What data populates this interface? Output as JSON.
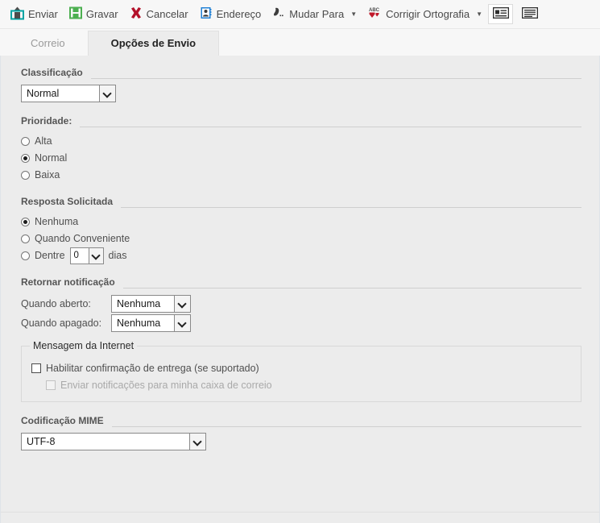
{
  "toolbar": {
    "items": [
      {
        "label": "Enviar",
        "icon": "send-icon",
        "has_caret": false
      },
      {
        "label": "Gravar",
        "icon": "save-icon",
        "has_caret": false
      },
      {
        "label": "Cancelar",
        "icon": "cancel-icon",
        "has_caret": false
      },
      {
        "label": "Endereço",
        "icon": "address-book-icon",
        "has_caret": false
      },
      {
        "label": "Mudar Para",
        "icon": "change-to-icon",
        "has_caret": true
      },
      {
        "label": "Corrigir Ortografia",
        "icon": "spellcheck-icon",
        "has_caret": true
      }
    ],
    "view_buttons": [
      {
        "name": "view-layout-side-icon",
        "selected": true
      },
      {
        "name": "view-layout-lines-icon",
        "selected": false
      }
    ],
    "caret_glyph": "▼"
  },
  "tabs": [
    {
      "label": "Correio",
      "active": false
    },
    {
      "label": "Opções de Envio",
      "active": true
    }
  ],
  "sections": {
    "classificacao": {
      "title": "Classificação",
      "select_value": "Normal"
    },
    "prioridade": {
      "title": "Prioridade:",
      "options": [
        {
          "label": "Alta",
          "selected": false
        },
        {
          "label": "Normal",
          "selected": true
        },
        {
          "label": "Baixa",
          "selected": false
        }
      ]
    },
    "resposta": {
      "title": "Resposta Solicitada",
      "options": [
        {
          "label": "Nenhuma",
          "selected": true
        },
        {
          "label": "Quando Conveniente",
          "selected": false
        },
        {
          "label": "Dentre",
          "selected": false
        }
      ],
      "days_value": "0",
      "days_suffix": "dias"
    },
    "retornar": {
      "title": "Retornar notificação",
      "rows": [
        {
          "caption": "Quando aberto:",
          "value": "Nenhuma"
        },
        {
          "caption": "Quando apagado:",
          "value": "Nenhuma"
        }
      ]
    },
    "mensagem_internet": {
      "legend": "Mensagem da Internet",
      "checks": [
        {
          "label": "Habilitar confirmação de entrega (se suportado)",
          "checked": false,
          "disabled": false
        },
        {
          "label": "Enviar notificações para minha caixa de correio",
          "checked": false,
          "disabled": true
        }
      ]
    },
    "mime": {
      "title": "Codificação MIME",
      "select_value": "UTF-8"
    }
  },
  "colors": {
    "panel_bg": "#ececec",
    "toolbar_bg": "#f7f7f7",
    "accent_teal": "#00a3a3",
    "accent_green": "#4caf50",
    "accent_red": "#b3112a",
    "accent_blue": "#1e7fd4"
  }
}
